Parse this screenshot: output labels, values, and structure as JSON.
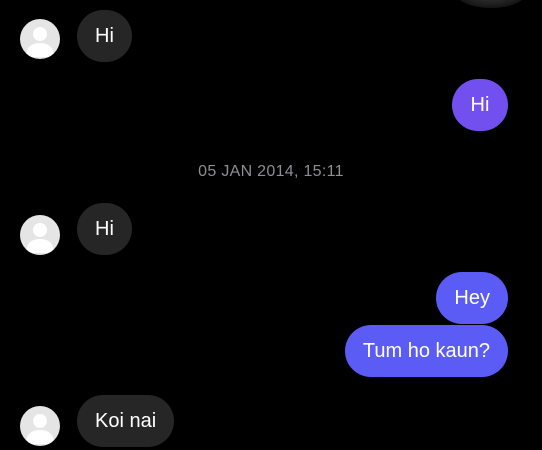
{
  "theme": {
    "background": "#000000",
    "incoming_bubble": "#262626",
    "outgoing_bubble": "#5b5cf6",
    "outgoing_bubble_alt": "#7250f0",
    "text": "#ffffff",
    "timestamp": "#8e8e93"
  },
  "messages": [
    {
      "direction": "incoming",
      "text": "Hi",
      "avatar": "default-user-avatar"
    },
    {
      "direction": "outgoing",
      "text": "Hi"
    },
    {
      "direction": "incoming",
      "text": "Hi",
      "avatar": "default-user-avatar"
    },
    {
      "direction": "outgoing",
      "text": "Hey"
    },
    {
      "direction": "outgoing",
      "text": "Tum ho kaun?"
    },
    {
      "direction": "incoming",
      "text": "Koi nai",
      "avatar": "default-user-avatar"
    }
  ],
  "timestamp": "05 JAN 2014, 15:11"
}
